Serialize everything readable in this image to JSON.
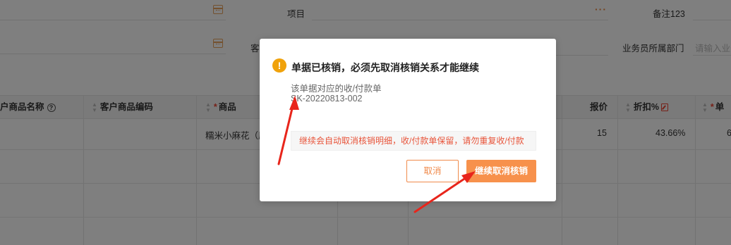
{
  "form": {
    "project_label": "项目",
    "note_label": "备注123",
    "customer_label": "客",
    "dept_label": "业务员所属部门",
    "dept_placeholder": "请输入业务",
    "more_dots": "···"
  },
  "table": {
    "columns": [
      {
        "label": "户商品名称"
      },
      {
        "label": "客户商品编码"
      },
      {
        "label": "商品"
      },
      {
        "label": "报价"
      },
      {
        "label": "折扣%"
      },
      {
        "label": "单"
      }
    ],
    "rows": [
      {
        "product": "糯米小麻花（原",
        "price": "15",
        "discount": "43.66%",
        "unit": "6"
      }
    ]
  },
  "dialog": {
    "icon": "!",
    "title": "单据已核销，必须先取消核销关系才能继续",
    "subtitle": "该单据对应的收/付款单",
    "doc_number": "SK-20220813-002",
    "warning": "继续会自动取消核销明细，收/付款单保留，请勿重复收/付款",
    "cancel_label": "取消",
    "confirm_label": "继续取消核销"
  },
  "colors": {
    "accent": "#f7914c",
    "warning_text": "#e8543a",
    "warning_icon": "#f0a20b",
    "arrow": "#e8251b"
  }
}
